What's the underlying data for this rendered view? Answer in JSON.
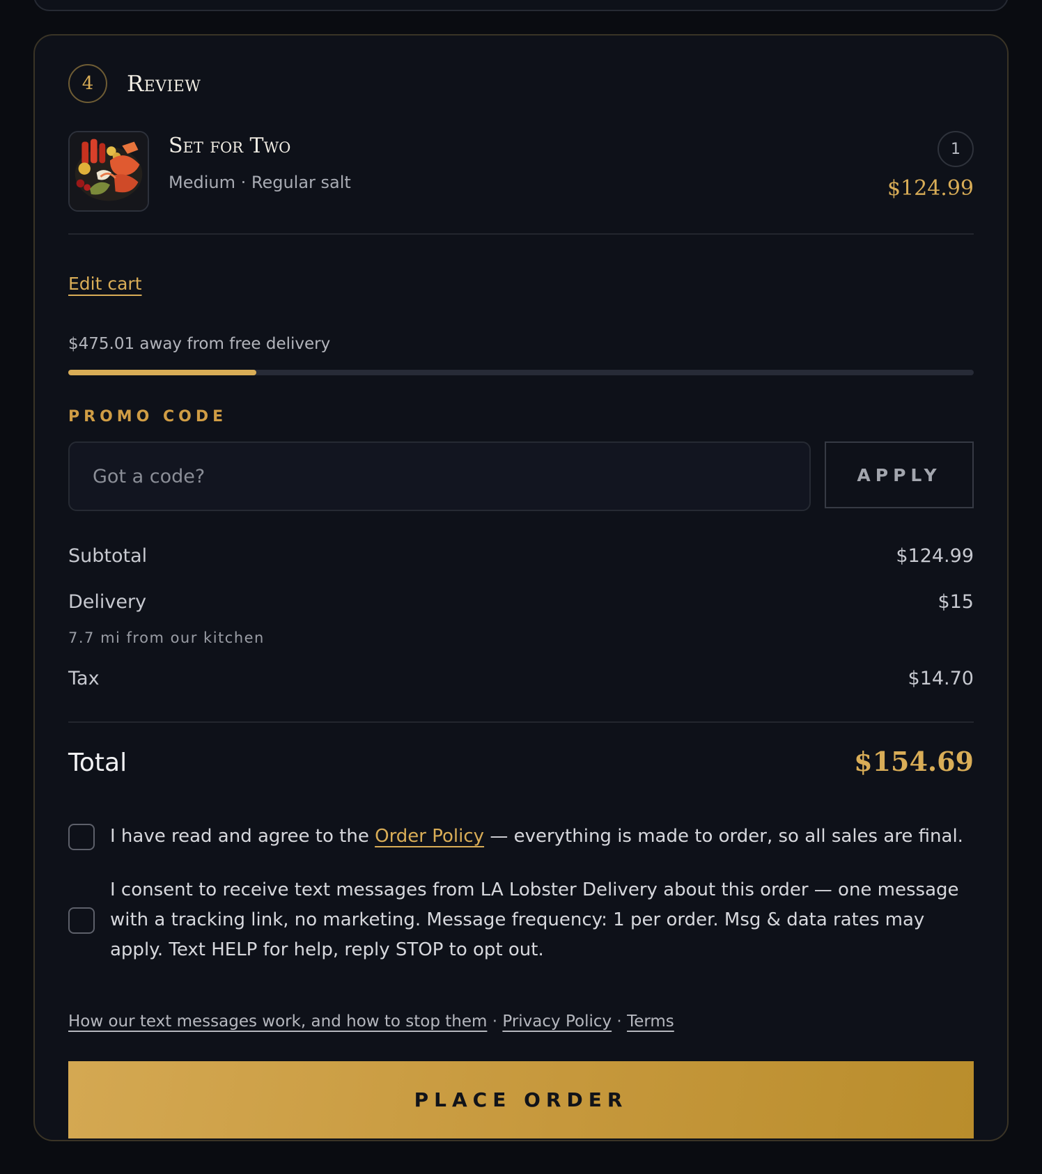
{
  "step": {
    "number": "4",
    "title": "Review"
  },
  "item": {
    "name": "Set for Two",
    "options": "Medium · Regular salt",
    "quantity": "1",
    "price": "$124.99",
    "image": "seafood-platter-image"
  },
  "edit_cart_label": "Edit cart",
  "free_delivery": {
    "text": "$475.01 away from free delivery",
    "progress": 0.208
  },
  "promo": {
    "label": "PROMO CODE",
    "placeholder": "Got a code?",
    "apply_label": "APPLY"
  },
  "summary": {
    "subtotal_label": "Subtotal",
    "subtotal": "$124.99",
    "delivery_label": "Delivery",
    "delivery": "$15",
    "delivery_note": "7.7 mi from our kitchen",
    "tax_label": "Tax",
    "tax": "$14.70",
    "total_label": "Total",
    "total": "$154.69"
  },
  "agreements": {
    "policy_prefix": "I have read and agree to the ",
    "policy_link": "Order Policy",
    "policy_suffix": " — everything is made to order, so all sales are final.",
    "sms_consent": "I consent to receive text messages from LA Lobster Delivery about this order — one message with a tracking link, no marketing. Message frequency: 1 per order. Msg & data rates may apply. Text HELP for help, reply STOP to opt out."
  },
  "footer_links": {
    "sms_info": "How our text messages work, and how to stop them",
    "separator": " · ",
    "privacy": "Privacy Policy",
    "terms": "Terms"
  },
  "place_order_label": "PLACE ORDER",
  "colors": {
    "accent": "#d9ad57",
    "background": "#0a0c11",
    "card": "#0e1119"
  }
}
